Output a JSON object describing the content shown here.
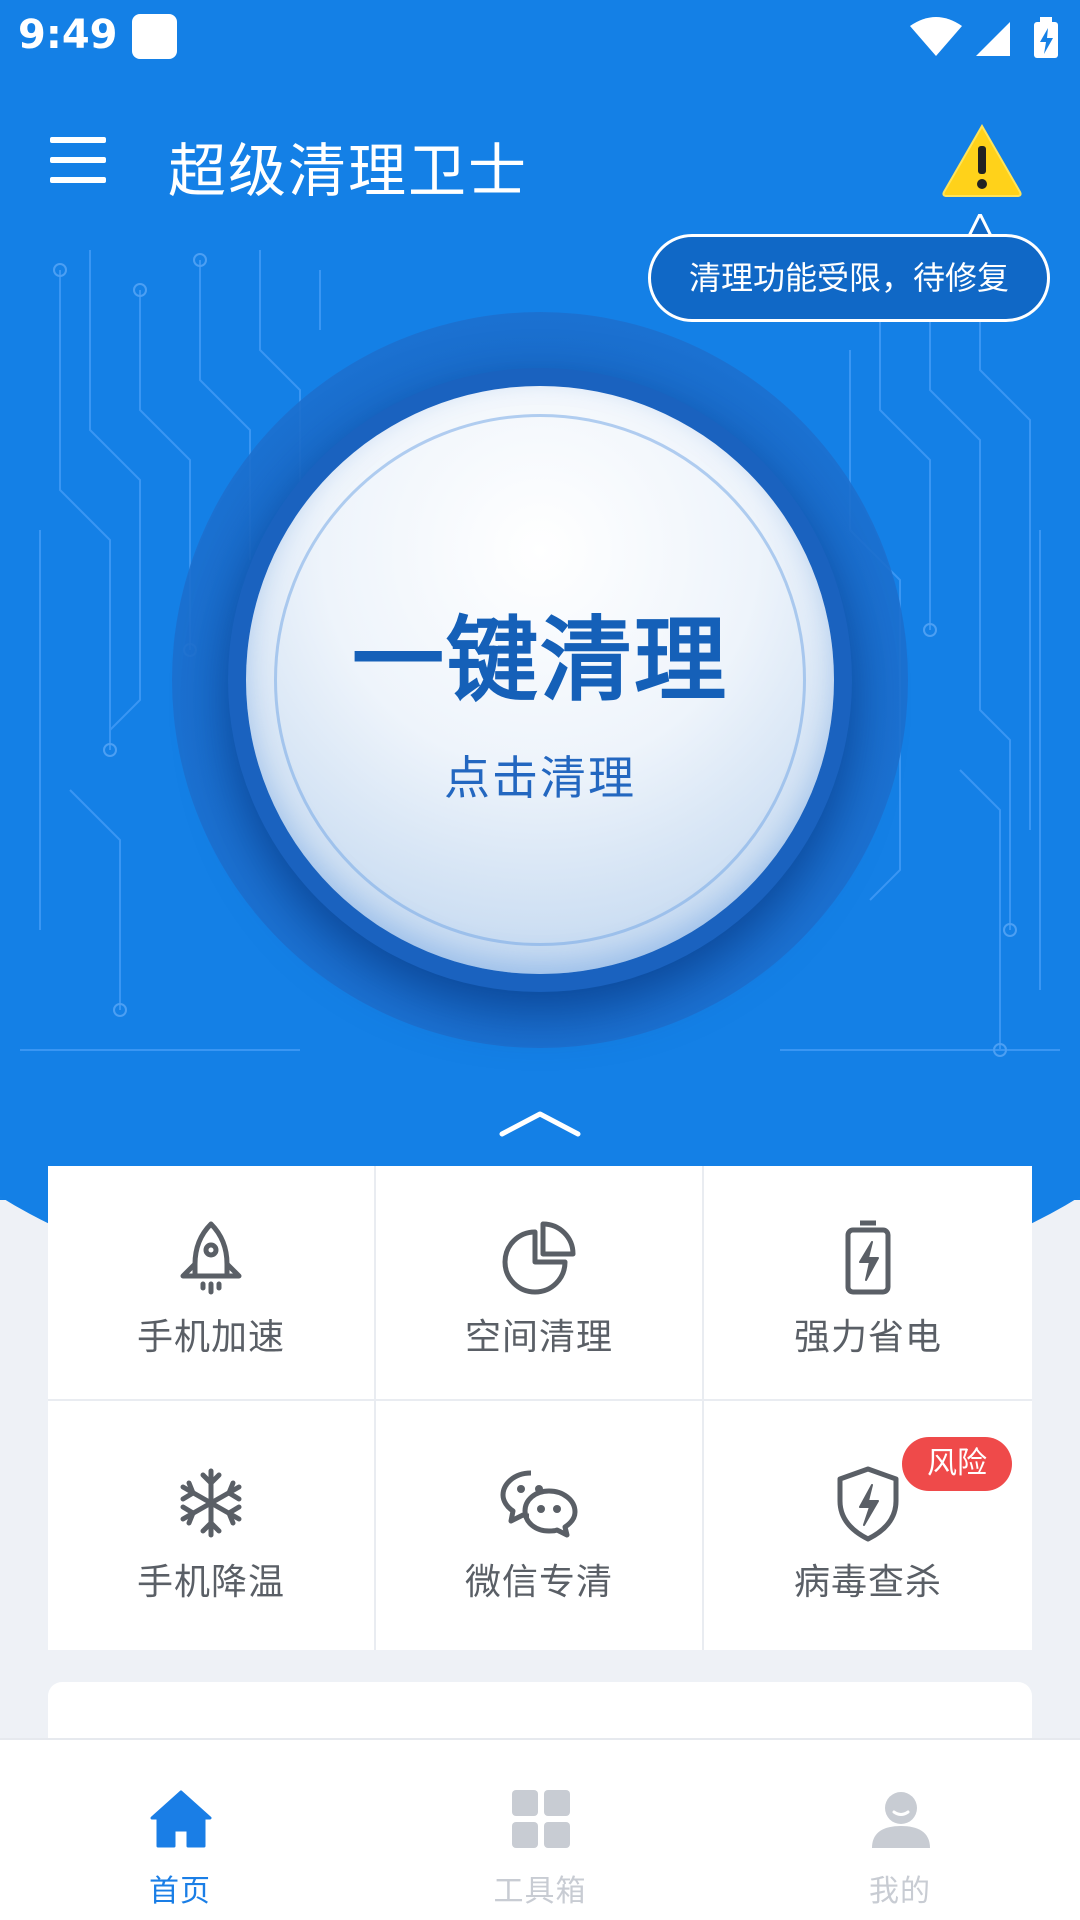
{
  "status_bar": {
    "time": "9:49"
  },
  "app_bar": {
    "title": "超级清理卫士"
  },
  "tooltip": {
    "text": "清理功能受限，待修复"
  },
  "clean_button": {
    "title": "一键清理",
    "subtitle": "点击清理"
  },
  "features": [
    {
      "label": "手机加速",
      "icon": "rocket-icon"
    },
    {
      "label": "空间清理",
      "icon": "pie-chart-icon"
    },
    {
      "label": "强力省电",
      "icon": "battery-icon"
    },
    {
      "label": "手机降温",
      "icon": "snowflake-icon"
    },
    {
      "label": "微信专清",
      "icon": "wechat-icon"
    },
    {
      "label": "病毒查杀",
      "icon": "shield-icon",
      "badge": "风险"
    }
  ],
  "bottom_nav": [
    {
      "label": "首页",
      "icon": "home-icon",
      "active": true
    },
    {
      "label": "工具箱",
      "icon": "grid-icon",
      "active": false
    },
    {
      "label": "我的",
      "icon": "person-icon",
      "active": false
    }
  ],
  "colors": {
    "primary": "#1480e6",
    "button_text": "#1560b8",
    "badge": "#ef4a4a",
    "nav_active": "#1a7ee6",
    "nav_inactive": "#c8ccd3"
  }
}
